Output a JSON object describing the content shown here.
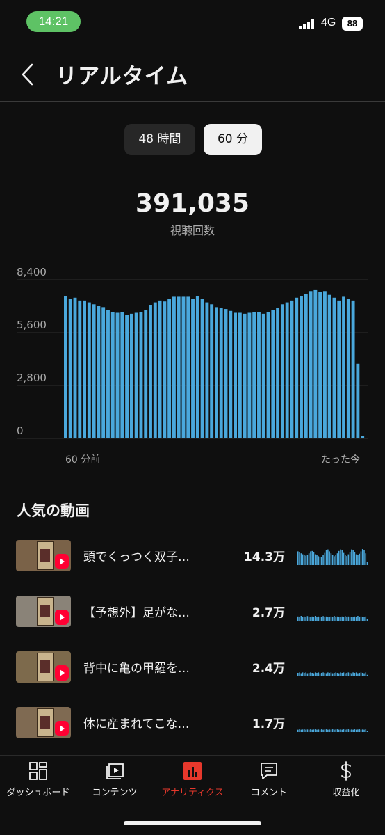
{
  "status_bar": {
    "time": "14:21",
    "network": "4G",
    "battery": "88"
  },
  "header": {
    "title": "リアルタイム"
  },
  "range_toggle": {
    "options": [
      "48 時間",
      "60 分"
    ],
    "selected": "60 分"
  },
  "summary": {
    "total_views": "391,035",
    "label": "視聴回数"
  },
  "chart_data": {
    "type": "bar",
    "y_ticks": [
      "8,400",
      "5,600",
      "2,800",
      "0"
    ],
    "ylim": [
      0,
      8400
    ],
    "x_start_label": "60 分前",
    "x_end_label": "たった今",
    "grid": true,
    "color": "#4aa8dc",
    "values": [
      7550,
      7400,
      7450,
      7300,
      7300,
      7200,
      7100,
      7000,
      6950,
      6800,
      6700,
      6650,
      6700,
      6550,
      6600,
      6650,
      6700,
      6800,
      7050,
      7200,
      7300,
      7250,
      7400,
      7500,
      7500,
      7500,
      7500,
      7400,
      7550,
      7400,
      7200,
      7100,
      6950,
      6900,
      6850,
      6750,
      6650,
      6650,
      6600,
      6650,
      6700,
      6700,
      6600,
      6700,
      6800,
      6900,
      7100,
      7200,
      7300,
      7450,
      7550,
      7650,
      7800,
      7850,
      7750,
      7800,
      7600,
      7450,
      7300,
      7500,
      7400,
      7300,
      3950,
      130
    ]
  },
  "popular": {
    "title": "人気の動画",
    "videos": [
      {
        "title": "頭でくっつく双子…",
        "views": "14.3万",
        "trend": [
          0.7,
          0.65,
          0.6,
          0.55,
          0.5,
          0.48,
          0.52,
          0.6,
          0.7,
          0.72,
          0.65,
          0.55,
          0.5,
          0.45,
          0.4,
          0.42,
          0.5,
          0.62,
          0.75,
          0.8,
          0.7,
          0.6,
          0.5,
          0.45,
          0.5,
          0.6,
          0.72,
          0.8,
          0.75,
          0.62,
          0.5,
          0.46,
          0.55,
          0.68,
          0.8,
          0.78,
          0.66,
          0.55,
          0.5,
          0.58,
          0.7,
          0.82,
          0.75,
          0.6,
          0.15
        ]
      },
      {
        "title": "【予想外】足がな…",
        "views": "2.7万",
        "trend": [
          0.22,
          0.2,
          0.25,
          0.18,
          0.22,
          0.2,
          0.24,
          0.2,
          0.18,
          0.22,
          0.2,
          0.25,
          0.2,
          0.22,
          0.18,
          0.2,
          0.24,
          0.2,
          0.22,
          0.2,
          0.18,
          0.22,
          0.2,
          0.25,
          0.2,
          0.22,
          0.2,
          0.18,
          0.22,
          0.2,
          0.24,
          0.2,
          0.22,
          0.2,
          0.18,
          0.2,
          0.22,
          0.2,
          0.25,
          0.2,
          0.22,
          0.2,
          0.18,
          0.22,
          0.1
        ]
      },
      {
        "title": "背中に亀の甲羅を…",
        "views": "2.4万",
        "trend": [
          0.18,
          0.2,
          0.16,
          0.2,
          0.18,
          0.2,
          0.16,
          0.18,
          0.2,
          0.18,
          0.16,
          0.2,
          0.18,
          0.2,
          0.16,
          0.18,
          0.2,
          0.18,
          0.16,
          0.2,
          0.18,
          0.2,
          0.16,
          0.18,
          0.2,
          0.18,
          0.16,
          0.2,
          0.18,
          0.2,
          0.16,
          0.18,
          0.2,
          0.18,
          0.16,
          0.2,
          0.18,
          0.2,
          0.16,
          0.18,
          0.2,
          0.18,
          0.16,
          0.2,
          0.08
        ]
      },
      {
        "title": "体に産まれてこな…",
        "views": "1.7万",
        "trend": [
          0.12,
          0.14,
          0.12,
          0.13,
          0.14,
          0.12,
          0.13,
          0.12,
          0.14,
          0.12,
          0.13,
          0.14,
          0.12,
          0.13,
          0.12,
          0.14,
          0.12,
          0.13,
          0.14,
          0.12,
          0.13,
          0.12,
          0.14,
          0.12,
          0.13,
          0.14,
          0.12,
          0.13,
          0.12,
          0.14,
          0.12,
          0.13,
          0.14,
          0.12,
          0.13,
          0.12,
          0.14,
          0.12,
          0.13,
          0.14,
          0.12,
          0.13,
          0.12,
          0.14,
          0.06
        ]
      }
    ]
  },
  "bottom_nav": {
    "items": [
      {
        "label": "ダッシュボード",
        "icon": "dashboard-icon"
      },
      {
        "label": "コンテンツ",
        "icon": "content-icon"
      },
      {
        "label": "アナリティクス",
        "icon": "analytics-icon",
        "active": true
      },
      {
        "label": "コメント",
        "icon": "comment-icon"
      },
      {
        "label": "収益化",
        "icon": "dollar-icon"
      }
    ],
    "active_color": "#e6382c"
  }
}
